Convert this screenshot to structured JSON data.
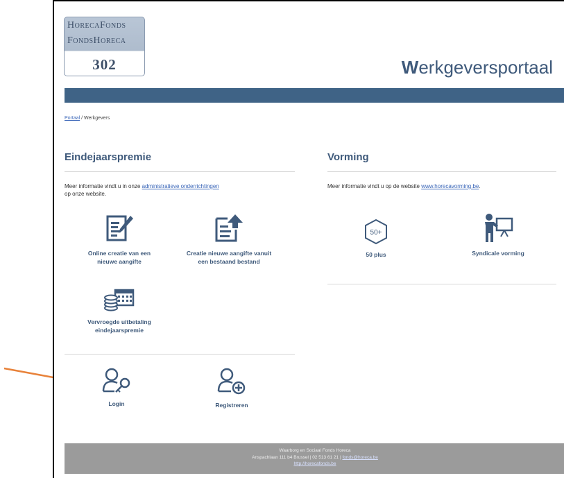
{
  "logo": {
    "line1": "HorecaFonds",
    "line2": "FondsHoreca",
    "number": "302"
  },
  "header": {
    "title_initial": "W",
    "title_rest": "erkgeversportaal"
  },
  "breadcrumb": {
    "link": "Portaal",
    "separator": " / ",
    "current": "Werkgevers"
  },
  "eindejaarspremie": {
    "title": "Eindejaarspremie",
    "info_prefix": "Meer informatie vindt u in onze ",
    "info_link": "administratieve onderrichtingen",
    "info_suffix": "op onze website.",
    "tiles": [
      {
        "label": "Online creatie van een nieuwe aangifte",
        "icon": "edit-form-icon"
      },
      {
        "label": "Creatie nieuwe aangifte vanuit een bestaand bestand",
        "icon": "upload-file-icon"
      },
      {
        "label": "Vervroegde uitbetaling eindejaarspremie",
        "icon": "coins-calendar-icon"
      }
    ]
  },
  "auth": {
    "login_label": "Login",
    "register_label": "Registreren"
  },
  "vorming": {
    "title": "Vorming",
    "info_prefix": "Meer informatie vindt u op de website ",
    "info_link": "www.horecavorming.be",
    "info_suffix": ".",
    "tiles": [
      {
        "label": "50 plus",
        "badge": "50+",
        "icon": "fifty-plus-icon"
      },
      {
        "label": "Syndicale vorming",
        "icon": "presenter-board-icon"
      }
    ]
  },
  "footer": {
    "line1": "Waarborg en Sociaal Fonds Horeca",
    "line2_text": "Anspachlaan 111 b4 Brussel | 02 513 61 21 | ",
    "email": "fonds@horeca.be",
    "url": "http://horecafonds.be"
  },
  "colors": {
    "brand_blue": "#3f6386",
    "title_blue": "#3f5a7b",
    "footer_gray": "#9b9b9b",
    "arrow_orange": "#e8823a"
  }
}
